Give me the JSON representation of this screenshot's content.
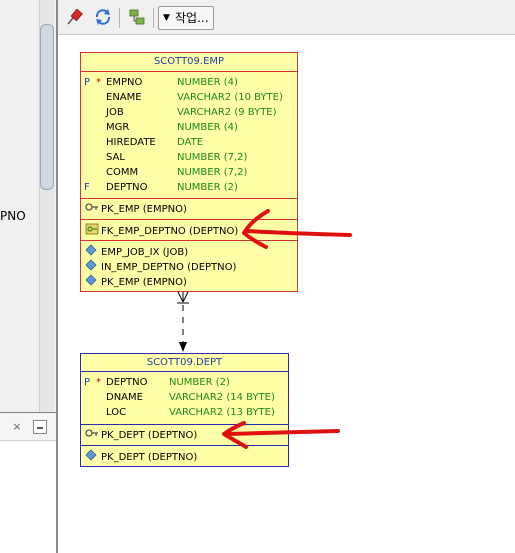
{
  "left_panel": {
    "text": "PNO",
    "close_glyph": "×"
  },
  "toolbar": {
    "icons": [
      "pin-icon",
      "refresh-icon",
      "layout-icon"
    ],
    "action_label": "작업...",
    "action_arrow": "▼"
  },
  "emp": {
    "title": "SCOTT09.EMP",
    "columns": [
      {
        "marker": "P",
        "star": "*",
        "name": "EMPNO",
        "type": "NUMBER (4)"
      },
      {
        "marker": "",
        "star": "",
        "name": "ENAME",
        "type": "VARCHAR2 (10 BYTE)"
      },
      {
        "marker": "",
        "star": "",
        "name": "JOB",
        "type": "VARCHAR2 (9 BYTE)"
      },
      {
        "marker": "",
        "star": "",
        "name": "MGR",
        "type": "NUMBER (4)"
      },
      {
        "marker": "",
        "star": "",
        "name": "HIREDATE",
        "type": "DATE"
      },
      {
        "marker": "",
        "star": "",
        "name": "SAL",
        "type": "NUMBER (7,2)"
      },
      {
        "marker": "",
        "star": "",
        "name": "COMM",
        "type": "NUMBER (7,2)"
      },
      {
        "marker": "F",
        "star": "",
        "name": "DEPTNO",
        "type": "NUMBER (2)"
      }
    ],
    "pk": "PK_EMP (EMPNO)",
    "fk": "FK_EMP_DEPTNO (DEPTNO)",
    "indexes": [
      "EMP_JOB_IX (JOB)",
      "IN_EMP_DEPTNO (DEPTNO)",
      "PK_EMP (EMPNO)"
    ]
  },
  "dept": {
    "title": "SCOTT09.DEPT",
    "columns": [
      {
        "marker": "P",
        "star": "*",
        "name": "DEPTNO",
        "type": "NUMBER (2)"
      },
      {
        "marker": "",
        "star": "",
        "name": "DNAME",
        "type": "VARCHAR2 (14 BYTE)"
      },
      {
        "marker": "",
        "star": "",
        "name": "LOC",
        "type": "VARCHAR2 (13 BYTE)"
      }
    ],
    "pk": "PK_DEPT (DEPTNO)",
    "indexes": [
      "PK_DEPT (DEPTNO)"
    ]
  },
  "colors": {
    "emp_border": "#d03535",
    "dept_border": "#2a2ab0",
    "table_bg": "#ffffa8",
    "title_text": "#1f3fa8",
    "type_text": "#1d8a1d",
    "annotation": "#e01010"
  }
}
